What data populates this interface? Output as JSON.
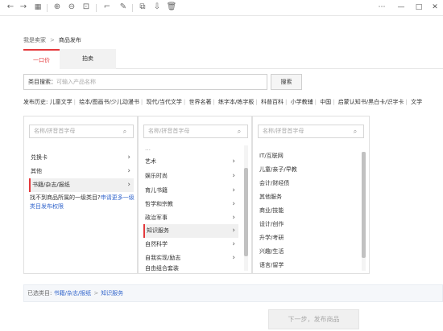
{
  "toolbar": {
    "icons": [
      "back-arrow-icon",
      "forward-arrow-icon",
      "grid-icon",
      "zoom-in-icon",
      "zoom-out-icon",
      "fit-icon",
      "crop-icon",
      "edit-icon",
      "copy-icon",
      "export-icon",
      "delete-icon"
    ],
    "window_controls": [
      "more-icon",
      "minimize-icon",
      "maximize-icon",
      "close-icon"
    ]
  },
  "breadcrumb": {
    "root": "我是卖家",
    "current": "商品发布"
  },
  "tabs": [
    {
      "label": "一口价",
      "active": true
    },
    {
      "label": "拍卖",
      "active": false
    }
  ],
  "search": {
    "label": "类目搜索：",
    "placeholder": "可输入产品名称",
    "button": "搜索"
  },
  "history": {
    "label": "发布历史:",
    "items": [
      "儿童文学",
      "绘本/图画书/少儿动漫书",
      "现代/当代文学",
      "世界名著",
      "练字本/练字板",
      "科普百科",
      "小学教辅",
      "中国",
      "启蒙认知书/黑白卡/识字卡",
      "文学"
    ]
  },
  "panel1": {
    "search_placeholder": "名称/拼音首字母",
    "items": [
      "兑换卡",
      "其他",
      "书籍/杂志/报纸"
    ],
    "selected_index": 2,
    "notfound_prefix": "找不到商品所属的一级类目?",
    "notfound_link": "申请更多一级类目发布权限"
  },
  "panel2": {
    "search_placeholder": "名称/拼音首字母",
    "items": [
      "…",
      "艺术",
      "娱乐时尚",
      "育儿书籍",
      "哲学和宗教",
      "政治军事",
      "知识服务",
      "自然科学",
      "自我实现/励志",
      "自由组合套装"
    ],
    "selected_index": 6
  },
  "panel3": {
    "search_placeholder": "名称/拼音首字母",
    "items": [
      "IT/互联网",
      "儿童/亲子/早教",
      "会计/财经债",
      "其他服务",
      "商业/技能",
      "设计/创作",
      "升学/考研",
      "兴趣/生活",
      "语言/留学"
    ]
  },
  "selected": {
    "label": "已选类目:",
    "level1": "书籍/杂志/报纸",
    "level2": "知识服务"
  },
  "next_button": "下一步，发布商品",
  "colors": {
    "accent": "#e4393c",
    "link": "#3366cc"
  }
}
